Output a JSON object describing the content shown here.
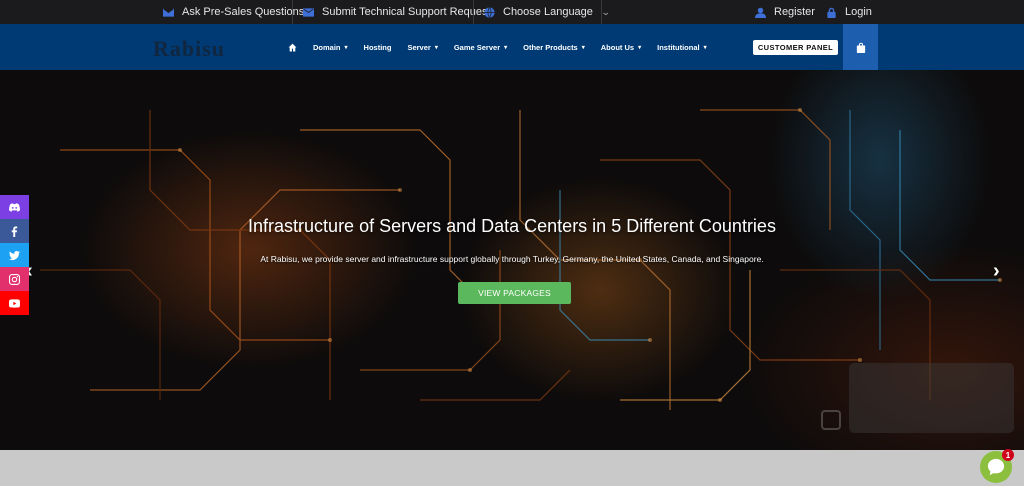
{
  "topbar": {
    "presales": "Ask Pre-Sales Questions",
    "support": "Submit Technical Support Request",
    "language": "Choose Language",
    "register": "Register",
    "login": "Login"
  },
  "navbar": {
    "logo": "Rabisu",
    "items": [
      {
        "label": "Domain"
      },
      {
        "label": "Hosting"
      },
      {
        "label": "Server"
      },
      {
        "label": "Game Server"
      },
      {
        "label": "Other Products"
      },
      {
        "label": "About Us"
      },
      {
        "label": "Institutional"
      }
    ],
    "customer_panel": "CUSTOMER PANEL"
  },
  "hero": {
    "title": "Infrastructure of Servers and Data Centers in 5 Different Countries",
    "subtitle": "At Rabisu, we provide server and infrastructure support globally through Turkey, Germany, the United States, Canada, and Singapore.",
    "cta": "VIEW PACKAGES",
    "prev": "‹",
    "next": "›"
  },
  "social": [
    {
      "name": "discord-icon",
      "color": "#7b3fe4"
    },
    {
      "name": "facebook-icon",
      "color": "#3b5998"
    },
    {
      "name": "twitter-icon",
      "color": "#1da1f2"
    },
    {
      "name": "instagram-icon",
      "color": "#e1306c"
    },
    {
      "name": "youtube-icon",
      "color": "#ff0000"
    }
  ],
  "chat": {
    "badge_count": "1"
  },
  "colors": {
    "topbar": "#1b1b1d",
    "navbar": "#003a75",
    "cart": "#1d5fae",
    "cta": "#5cb85c",
    "chat": "#8cbf3d"
  }
}
